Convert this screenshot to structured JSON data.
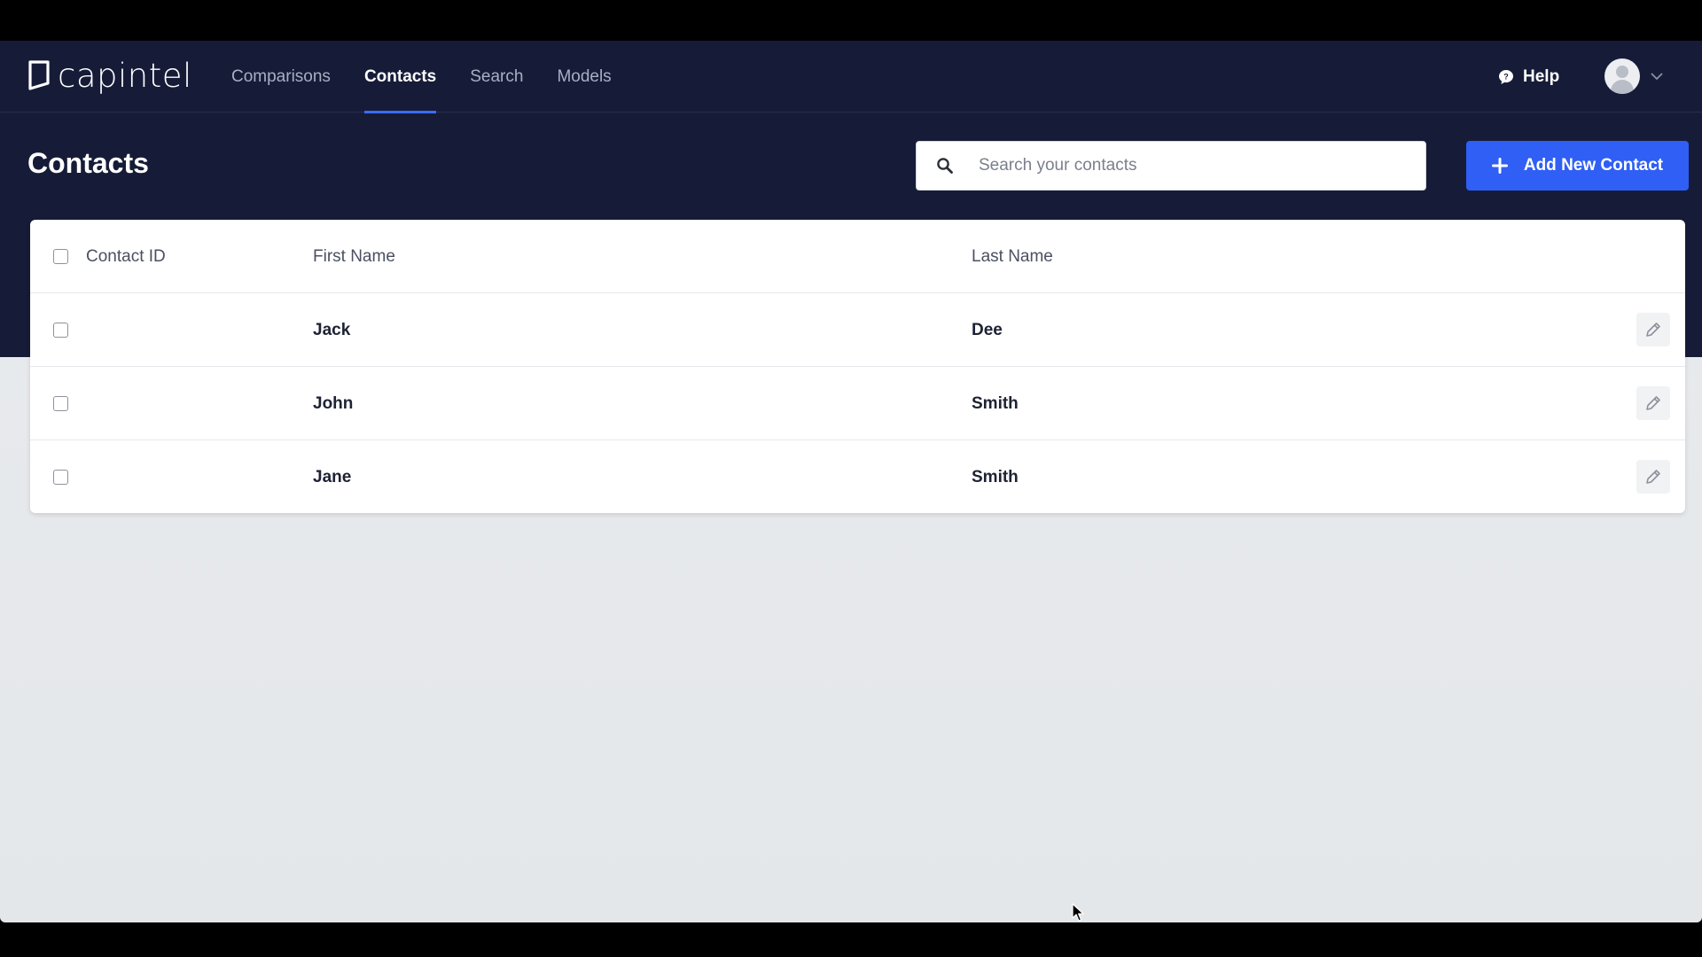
{
  "brand": {
    "name": "capintel"
  },
  "nav": {
    "links": [
      {
        "label": "Comparisons",
        "active": false
      },
      {
        "label": "Contacts",
        "active": true
      },
      {
        "label": "Search",
        "active": false
      },
      {
        "label": "Models",
        "active": false
      }
    ],
    "help_label": "Help"
  },
  "page": {
    "title": "Contacts"
  },
  "search": {
    "placeholder": "Search your contacts",
    "value": ""
  },
  "add_button": {
    "label": "Add New Contact"
  },
  "table": {
    "columns": [
      "Contact ID",
      "First Name",
      "Last Name"
    ],
    "rows": [
      {
        "contact_id": "",
        "first_name": "Jack",
        "last_name": "Dee"
      },
      {
        "contact_id": "",
        "first_name": "John",
        "last_name": "Smith"
      },
      {
        "contact_id": "",
        "first_name": "Jane",
        "last_name": "Smith"
      }
    ]
  },
  "colors": {
    "header_bg": "#161c38",
    "accent": "#2f5ff5",
    "nav_active_underline": "#3b6cf6",
    "page_bg": "#e6e9ec"
  },
  "icons": [
    "logo-mark-icon",
    "help-chat-icon",
    "avatar-icon",
    "chevron-down-icon",
    "search-icon",
    "plus-icon",
    "pencil-icon",
    "mouse-cursor-icon"
  ]
}
